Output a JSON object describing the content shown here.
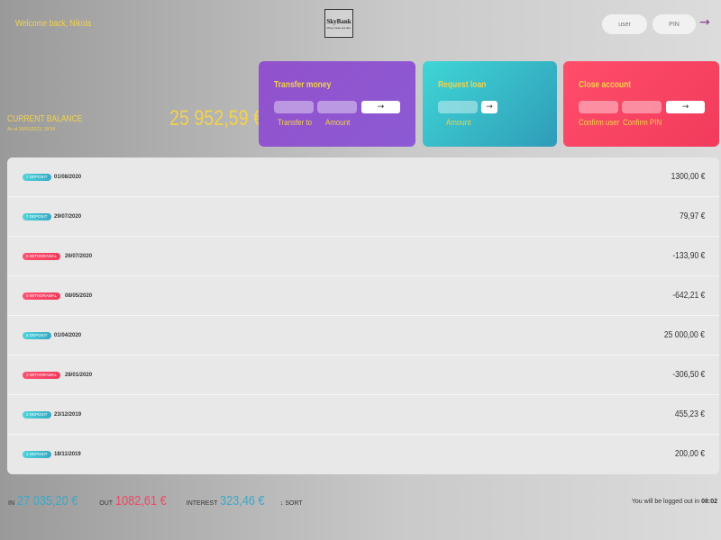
{
  "header": {
    "welcome": "Welcome back, Nikola",
    "logo_name": "SkyBank",
    "logo_tagline": "Money, banks and skies",
    "login_user_placeholder": "user",
    "login_pin_placeholder": "PIN",
    "login_arrow": "→"
  },
  "balance": {
    "label": "CURRENT BALANCE",
    "date": "As of 30/01/2023, 18:54",
    "value": "25 952,59 €"
  },
  "operations": {
    "transfer": {
      "title": "Transfer money",
      "label_to": "Transfer to",
      "label_amount": "Amount",
      "button": "→"
    },
    "loan": {
      "title": "Request loan",
      "label_amount": "Amount",
      "button": "→"
    },
    "close": {
      "title": "Close account",
      "label_user": "Confirm user",
      "label_pin": "Confirm PIN",
      "button": "→"
    }
  },
  "movements": [
    {
      "type": "7 deposit",
      "kind": "deposit",
      "date": "01/08/2020",
      "value": "1300,00 €"
    },
    {
      "type": "7 deposit",
      "kind": "deposit",
      "date": "29/07/2020",
      "value": "79,97 €"
    },
    {
      "type": "6 withdrawal",
      "kind": "withdrawal",
      "date": "26/07/2020",
      "value": "-133,90 €"
    },
    {
      "type": "5 withdrawal",
      "kind": "withdrawal",
      "date": "08/05/2020",
      "value": "-642,21 €"
    },
    {
      "type": "4 deposit",
      "kind": "deposit",
      "date": "01/04/2020",
      "value": "25 000,00 €"
    },
    {
      "type": "3 withdrawal",
      "kind": "withdrawal",
      "date": "28/01/2020",
      "value": "-306,50 €"
    },
    {
      "type": "2 deposit",
      "kind": "deposit",
      "date": "23/12/2019",
      "value": "455,23 €"
    },
    {
      "type": "1 deposit",
      "kind": "deposit",
      "date": "18/11/2019",
      "value": "200,00 €"
    }
  ],
  "summary": {
    "in_label": "In",
    "in_value": "27 035,20 €",
    "out_label": "Out",
    "out_value": "1082,61 €",
    "interest_label": "Interest",
    "interest_value": "323,46 €",
    "sort_label": "↓ SORT"
  },
  "logout": {
    "text": "You will be logged out in",
    "timer": "08:02"
  },
  "colors": {
    "accent_yellow": "#f2d24b",
    "deposit": "#3aa9c8",
    "withdrawal": "#f04765",
    "transfer_card": "#9251cc",
    "loan_card": "#3fd6d6",
    "close_card": "#ff4d6a"
  }
}
